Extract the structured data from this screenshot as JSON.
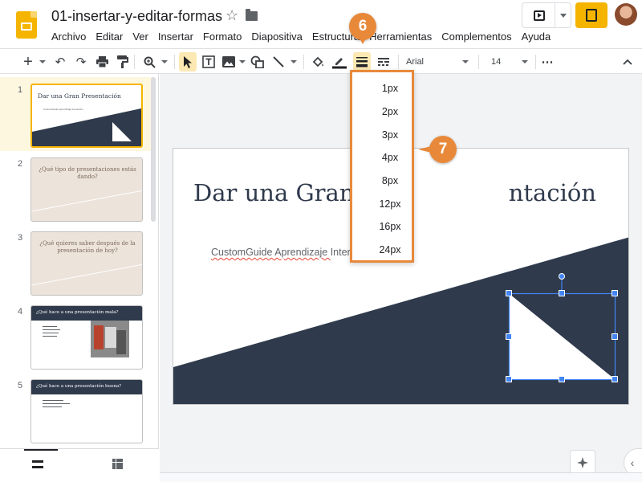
{
  "app": {
    "doc_title": "01-insertar-y-editar-formas"
  },
  "menu": [
    "Archivo",
    "Editar",
    "Ver",
    "Insertar",
    "Formato",
    "Diapositiva",
    "Estructura",
    "Herramientas",
    "Complementos",
    "Ayuda"
  ],
  "toolbar": {
    "font_name": "Arial",
    "font_size": "14",
    "more": "⋯"
  },
  "filmstrip": {
    "slides": [
      {
        "number": "1",
        "title": "Dar una Gran Presentación",
        "subtitle": "CustomGuide Aprendizaje Interactivo"
      },
      {
        "number": "2",
        "title": "¿Qué tipo de presentaciones estás dando?"
      },
      {
        "number": "3",
        "title": "¿Qué quieres saber después de la presentación de hoy?"
      },
      {
        "number": "4",
        "title": "¿Qué hace a una presentación mala?"
      },
      {
        "number": "5",
        "title": "¿Qué hace a una presentación buena?"
      }
    ]
  },
  "slide": {
    "title_left": "Dar una Gran ",
    "title_right": "ntación",
    "subtitle_left": "CustomGuide Aprendizaje ",
    "subtitle_right": "Inter"
  },
  "line_weight_dropdown": {
    "options": [
      "1px",
      "2px",
      "3px",
      "4px",
      "8px",
      "12px",
      "16px",
      "24px"
    ]
  },
  "callouts": {
    "step6": "6",
    "step7": "7"
  },
  "colors": {
    "accent": "#e8893a",
    "slides_yellow": "#f4b400",
    "slide_dark": "#2f3a4c",
    "selection_blue": "#4285f4"
  }
}
